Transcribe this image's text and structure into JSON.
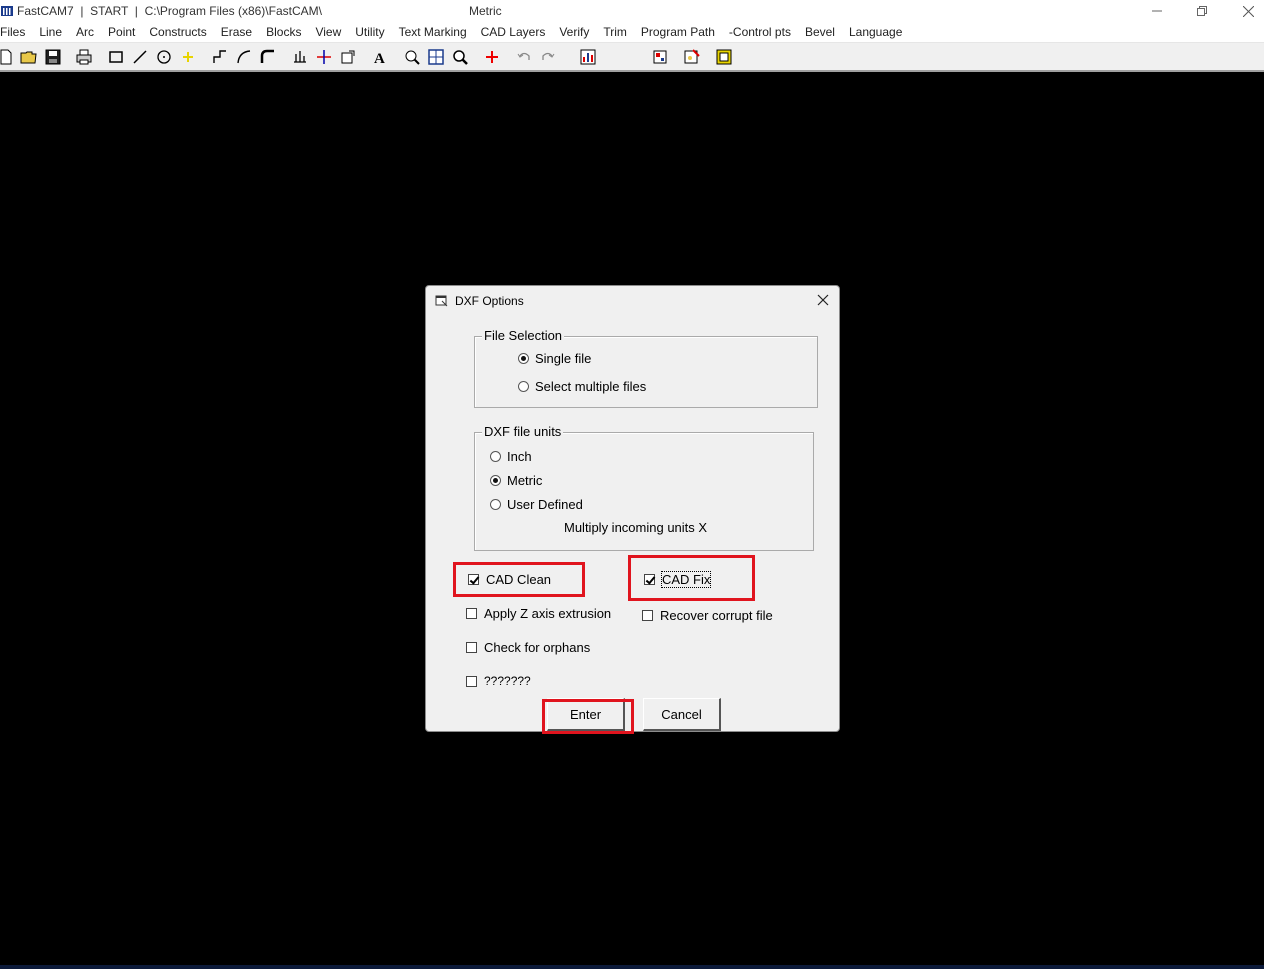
{
  "window": {
    "title": "FastCAM7  |  START  |  C:\\Program Files (x86)\\FastCAM\\",
    "units_label": "Metric",
    "minimize_icon": "minimize-icon",
    "maximize_icon": "restore-icon",
    "close_icon": "close-icon"
  },
  "menu": [
    "Files",
    "Line",
    "Arc",
    "Point",
    "Constructs",
    "Erase",
    "Blocks",
    "View",
    "Utility",
    "Text Marking",
    "CAD Layers",
    "Verify",
    "Trim",
    "Program Path",
    "-Control pts",
    "Bevel",
    "Language"
  ],
  "toolbar": {
    "icons": [
      "new-file-icon",
      "open-folder-icon",
      "save-icon",
      "print-icon",
      "rectangle-icon",
      "line-icon",
      "circle-icon",
      "point-icon",
      "step-line-icon",
      "arc-tangent-icon",
      "fillet-icon",
      "path-icon",
      "measure-icon",
      "export-icon",
      "text-icon",
      "zoom-window-icon",
      "zoom-all-icon",
      "zoom-icon",
      "origin-icon",
      "undo-icon",
      "redo-icon",
      "chart-icon",
      "nest-icon",
      "process-icon",
      "post-icon"
    ]
  },
  "dialog": {
    "title": "DXF Options",
    "file_selection": {
      "label": "File Selection",
      "options": [
        "Single file",
        "Select multiple files"
      ],
      "selected": "Single file"
    },
    "units": {
      "label": "DXF file units",
      "options": [
        "Inch",
        "Metric",
        "User Defined"
      ],
      "selected": "Metric",
      "multiply_label": "Multiply incoming units X"
    },
    "checks": {
      "cad_clean": {
        "label": "CAD Clean",
        "checked": true
      },
      "cad_fix": {
        "label": "CAD Fix",
        "checked": true
      },
      "apply_z": {
        "label": "Apply Z axis extrusion",
        "checked": false
      },
      "recover": {
        "label": "Recover corrupt file",
        "checked": false
      },
      "orphans": {
        "label": "Check for orphans",
        "checked": false
      },
      "unknown": {
        "label": "???????",
        "checked": false
      }
    },
    "buttons": {
      "enter": "Enter",
      "cancel": "Cancel"
    },
    "highlight_color": "#e0141e"
  }
}
